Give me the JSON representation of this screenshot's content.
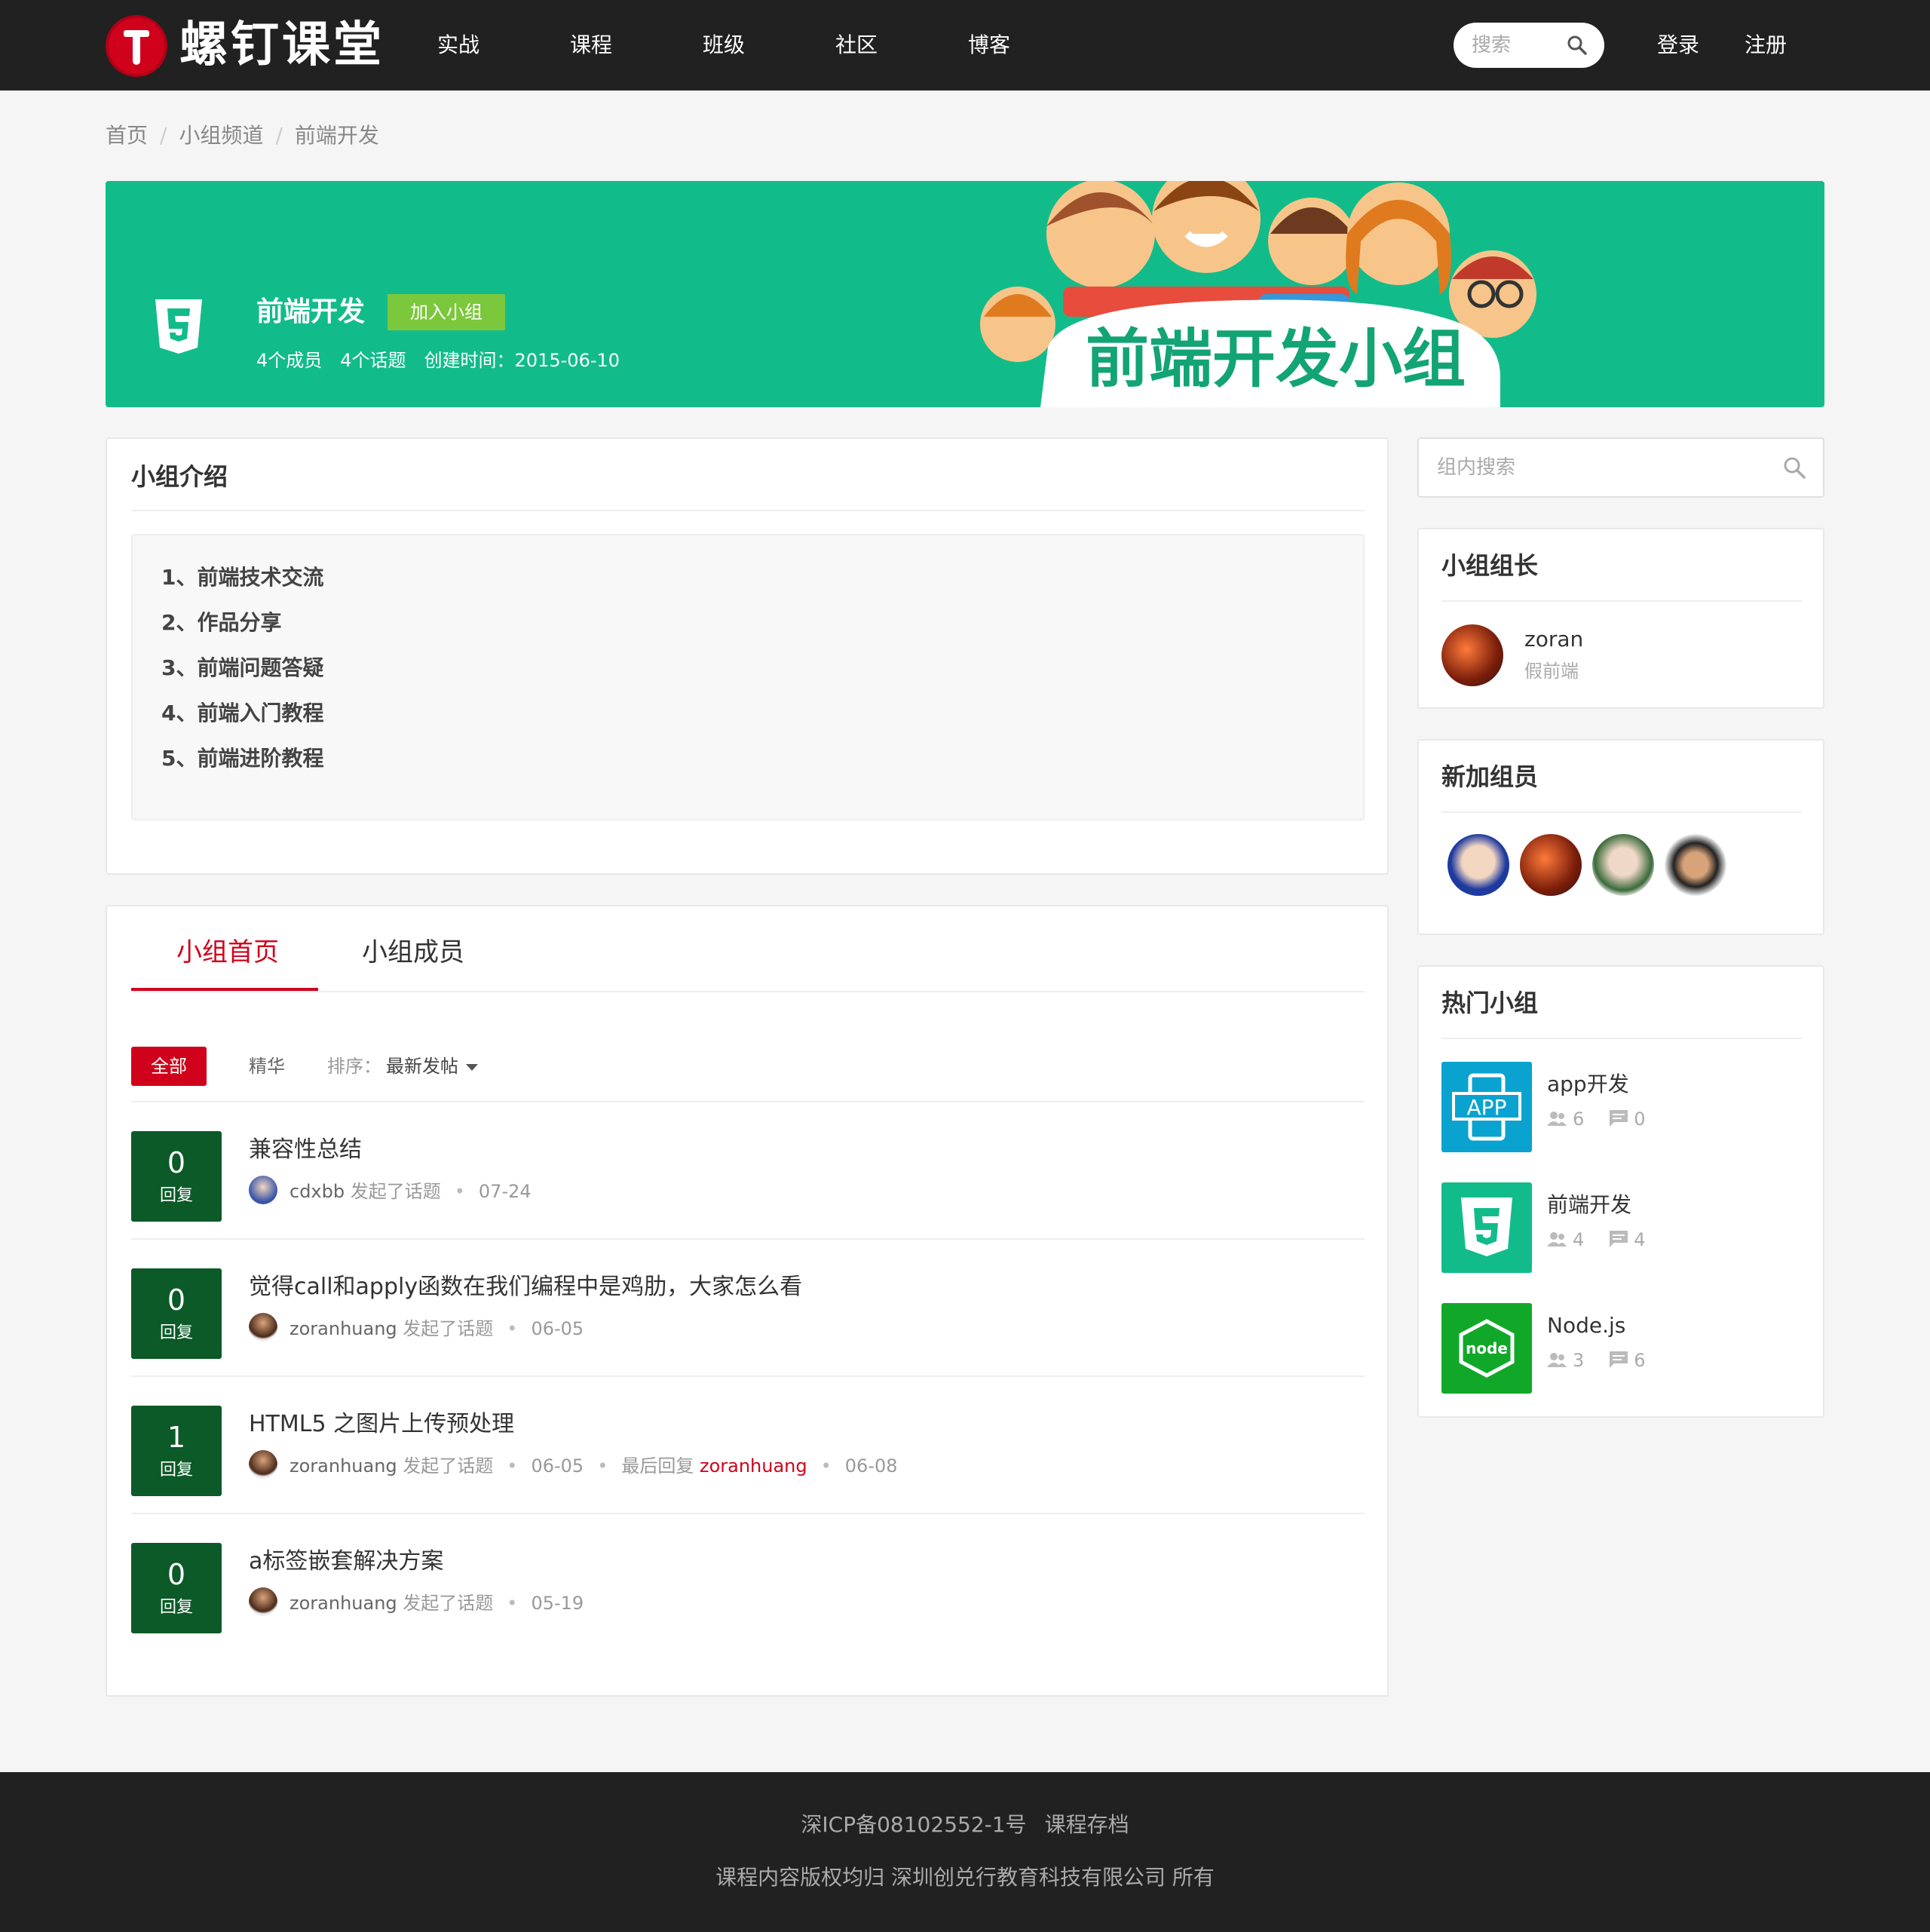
{
  "nav": {
    "logo_text": "螺钉课堂",
    "items": [
      "实战",
      "课程",
      "班级",
      "社区",
      "博客"
    ],
    "search_placeholder": "搜索",
    "login": "登录",
    "register": "注册"
  },
  "breadcrumb": [
    "首页",
    "小组频道",
    "前端开发"
  ],
  "banner": {
    "group_name": "前端开发",
    "join_label": "加入小组",
    "members": "4个成员",
    "topics": "4个话题",
    "created": "创建时间：2015-06-10",
    "illustration_text": "前端开发小组"
  },
  "intro": {
    "title": "小组介绍",
    "items": [
      "1、前端技术交流",
      "2、作品分享",
      "3、前端问题答疑",
      "4、前端入门教程",
      "5、前端进阶教程"
    ]
  },
  "tabs": [
    "小组首页",
    "小组成员"
  ],
  "filters": {
    "all": "全部",
    "featured": "精华",
    "sort_label": "排序：",
    "sort_value": "最新发帖"
  },
  "topics": [
    {
      "replies": "0",
      "reply_label": "回复",
      "title": "兼容性总结",
      "author": "cdxbb",
      "action": "发起了话题",
      "date": "07-24"
    },
    {
      "replies": "0",
      "reply_label": "回复",
      "title": "觉得call和apply函数在我们编程中是鸡肋，大家怎么看",
      "author": "zoranhuang",
      "action": "发起了话题",
      "date": "06-05"
    },
    {
      "replies": "1",
      "reply_label": "回复",
      "title": "HTML5 之图片上传预处理",
      "author": "zoranhuang",
      "action": "发起了话题",
      "date": "06-05",
      "last_reply_label": "最后回复",
      "last_reply_user": "zoranhuang",
      "last_reply_date": "06-08"
    },
    {
      "replies": "0",
      "reply_label": "回复",
      "title": "a标签嵌套解决方案",
      "author": "zoranhuang",
      "action": "发起了话题",
      "date": "05-19"
    }
  ],
  "sidebar": {
    "search_placeholder": "组内搜索",
    "leader": {
      "title": "小组组长",
      "name": "zoran",
      "role": "假前端"
    },
    "new_members_title": "新加组员",
    "hot_groups": {
      "title": "热门小组",
      "items": [
        {
          "name": "app开发",
          "members": "6",
          "topics": "0",
          "color": "#0aa3cf"
        },
        {
          "name": "前端开发",
          "members": "4",
          "topics": "4",
          "color": "#12bc8a"
        },
        {
          "name": "Node.js",
          "members": "3",
          "topics": "6",
          "color": "#11a82a"
        }
      ]
    }
  },
  "footer": {
    "icp": "深ICP备08102552-1号",
    "archive": "课程存档",
    "copyright": "课程内容版权均归 深圳创兑行教育科技有限公司 所有"
  },
  "colors": {
    "accent": "#d0021b",
    "banner": "#12bc8a",
    "reply_box": "#0b5a27",
    "join": "#7cc83c"
  }
}
